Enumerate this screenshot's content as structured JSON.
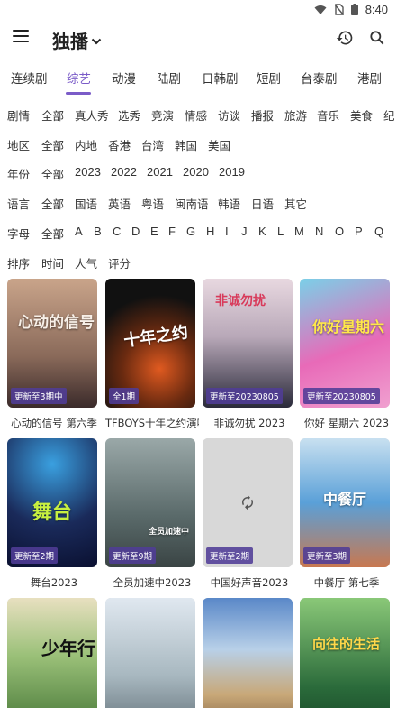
{
  "status_bar": {
    "time": "8:40"
  },
  "app_bar": {
    "title": "独播"
  },
  "tabs": [
    {
      "label": "连续剧",
      "active": false
    },
    {
      "label": "综艺",
      "active": true
    },
    {
      "label": "动漫",
      "active": false
    },
    {
      "label": "陆剧",
      "active": false
    },
    {
      "label": "日韩剧",
      "active": false
    },
    {
      "label": "短剧",
      "active": false
    },
    {
      "label": "台泰剧",
      "active": false
    },
    {
      "label": "港剧",
      "active": false
    }
  ],
  "filters": {
    "genre": {
      "label": "剧情",
      "options": [
        "全部",
        "真人秀",
        "选秀",
        "竞演",
        "情感",
        "访谈",
        "播报",
        "旅游",
        "音乐",
        "美食",
        "纪"
      ]
    },
    "region": {
      "label": "地区",
      "options": [
        "全部",
        "内地",
        "香港",
        "台湾",
        "韩国",
        "美国"
      ]
    },
    "year": {
      "label": "年份",
      "options": [
        "全部",
        "2023",
        "2022",
        "2021",
        "2020",
        "2019"
      ]
    },
    "language": {
      "label": "语言",
      "options": [
        "全部",
        "国语",
        "英语",
        "粤语",
        "闽南语",
        "韩语",
        "日语",
        "其它"
      ]
    },
    "letter": {
      "label": "字母",
      "options": [
        "全部",
        "A",
        "B",
        "C",
        "D",
        "E",
        "F",
        "G",
        "H",
        "I",
        "J",
        "K",
        "L",
        "M",
        "N",
        "O",
        "P",
        "Q"
      ]
    },
    "sort": {
      "label": "排序",
      "options": [
        "时间",
        "人气",
        "评分"
      ]
    }
  },
  "cards": [
    {
      "title": "心动的信号 第六季",
      "badge": "更新至3期中",
      "poster_text": "心动的信号",
      "color1": "#8a6a5a",
      "color2": "#c9a48a"
    },
    {
      "title": "TFBOYS十年之约演唱会",
      "badge": "全1期",
      "poster_text": "十年之约",
      "color1": "#1a1a1a",
      "color2": "#4a2a1a"
    },
    {
      "title": "非诚勿扰 2023",
      "badge": "更新至20230805",
      "poster_text": "非诚勿扰",
      "color1": "#b8a8b8",
      "color2": "#e8d8e0"
    },
    {
      "title": "你好 星期六 2023",
      "badge": "更新至20230805",
      "poster_text": "你好星期六",
      "color1": "#e86ab8",
      "color2": "#7ad0e8"
    },
    {
      "title": "舞台2023",
      "badge": "更新至2期",
      "poster_text": "舞台",
      "color1": "#1a2a5a",
      "color2": "#3aa0e0"
    },
    {
      "title": "全员加速中2023",
      "badge": "更新至9期",
      "poster_text": "全员加速中",
      "color1": "#5a6a6a",
      "color2": "#9aa8a8"
    },
    {
      "title": "中国好声音2023",
      "badge": "更新至2期",
      "poster_text": "",
      "color1": "#d8d8d8",
      "color2": "#d8d8d8"
    },
    {
      "title": "中餐厅 第七季",
      "badge": "更新至3期",
      "poster_text": "中餐厅",
      "color1": "#5aa0d8",
      "color2": "#c8e0f0"
    },
    {
      "title": "",
      "badge": "",
      "poster_text": "少年行",
      "color1": "#6a9a5a",
      "color2": "#e8e0c0"
    },
    {
      "title": "",
      "badge": "",
      "poster_text": "",
      "color1": "#a8b8c0",
      "color2": "#e0e8f0"
    },
    {
      "title": "",
      "badge": "",
      "poster_text": "",
      "color1": "#5a88c8",
      "color2": "#c8a878"
    },
    {
      "title": "",
      "badge": "",
      "poster_text": "向往的生活",
      "color1": "#2a6a3a",
      "color2": "#8ac878"
    }
  ],
  "colors": {
    "accent": "#7b5cc8",
    "badge_bg": "#503c96"
  },
  "icons": [
    "wifi-icon",
    "no-sim-icon",
    "battery-icon",
    "menu-icon",
    "chevron-down-icon",
    "history-icon",
    "search-icon",
    "refresh-icon"
  ]
}
